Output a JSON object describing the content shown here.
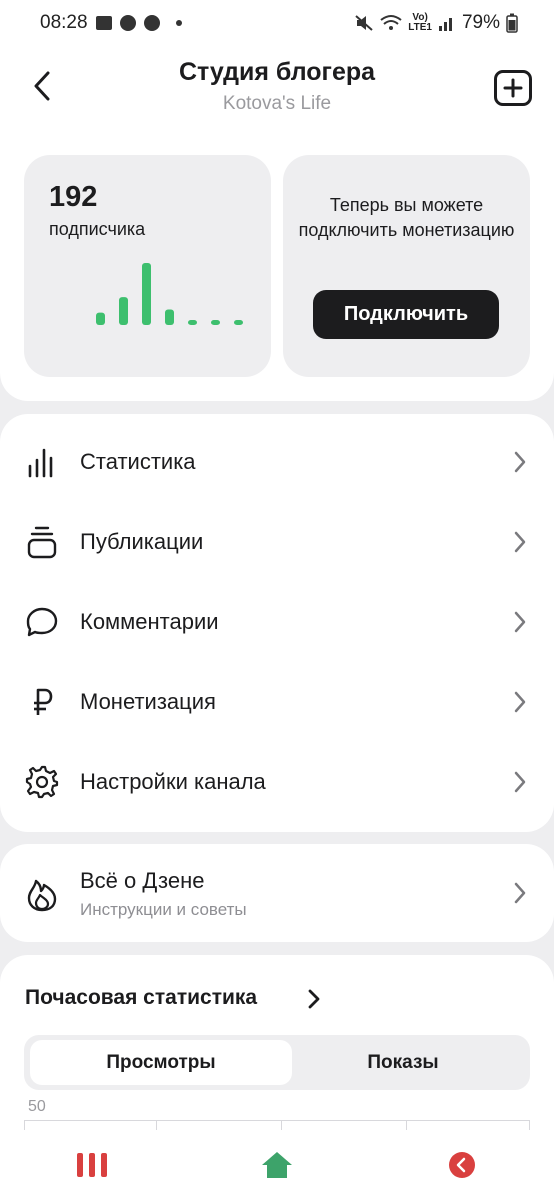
{
  "status_bar": {
    "time": "08:28",
    "net_label_top": "Vo)",
    "net_label_bottom": "LTE1",
    "battery": "79%"
  },
  "header": {
    "title": "Студия блогера",
    "subtitle": "Kotova's Life"
  },
  "subscribers": {
    "count": "192",
    "label": "подписчика",
    "bars": [
      0.2,
      0.45,
      1.0,
      0.25,
      0.08,
      0.08,
      0.08
    ],
    "bar_color": "#3dbf6e"
  },
  "monetization_card": {
    "text": "Теперь вы можете подключить монетизацию",
    "button": "Подключить"
  },
  "menu": {
    "items": [
      {
        "label": "Статистика",
        "icon": "bar-chart-icon"
      },
      {
        "label": "Публикации",
        "icon": "publications-icon"
      },
      {
        "label": "Комментарии",
        "icon": "comment-icon"
      },
      {
        "label": "Монетизация",
        "icon": "ruble-icon"
      },
      {
        "label": "Настройки канала",
        "icon": "gear-icon"
      }
    ]
  },
  "zen": {
    "title": "Всё о Дзене",
    "subtitle": "Инструкции и советы",
    "icon": "flame-icon"
  },
  "hourly_stats": {
    "title": "Почасовая статистика",
    "tabs": [
      "Просмотры",
      "Показы"
    ],
    "active_tab": "Просмотры",
    "y_max_label": "50"
  },
  "nav": {
    "recents_icon": "recent-apps-icon",
    "home_icon": "home-icon",
    "back_icon": "back-icon"
  },
  "colors": {
    "accent_green": "#3dbf6e",
    "dark": "#1c1c1e",
    "muted": "#9a9a9e"
  }
}
